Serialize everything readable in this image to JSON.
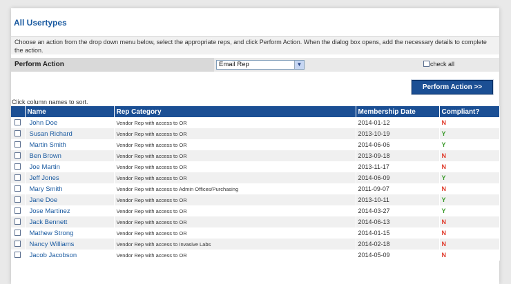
{
  "page": {
    "title": "All Usertypes",
    "instructions": "Choose an action from the drop down menu below, select the appropriate reps, and click Perform Action. When the dialog box opens, add the necessary details to complete the action.",
    "perform_action_label": "Perform Action",
    "action_select_value": "Email Rep",
    "check_all_label": "check all",
    "perform_button_label": "Perform Action >>",
    "sort_hint": "Click column names to sort."
  },
  "table": {
    "columns": [
      "Name",
      "Rep Category",
      "Membership Date",
      "Compliant?"
    ],
    "rows": [
      {
        "name": "John Doe",
        "category": "Vendor Rep with access to OR",
        "date": "2014-01-12",
        "compliant": "N"
      },
      {
        "name": "Susan Richard",
        "category": "Vendor Rep with access to OR",
        "date": "2013-10-19",
        "compliant": "Y"
      },
      {
        "name": "Martin Smith",
        "category": "Vendor Rep with access to OR",
        "date": "2014-06-06",
        "compliant": "Y"
      },
      {
        "name": "Ben Brown",
        "category": "Vendor Rep with access to OR",
        "date": "2013-09-18",
        "compliant": "N"
      },
      {
        "name": "Joe Martin",
        "category": "Vendor Rep with access to OR",
        "date": "2013-11-17",
        "compliant": "N"
      },
      {
        "name": "Jeff Jones",
        "category": "Vendor Rep with access to OR",
        "date": "2014-06-09",
        "compliant": "Y"
      },
      {
        "name": "Mary Smith",
        "category": "Vendor Rep with access to Admin Offices/Purchasing",
        "date": "2011-09-07",
        "compliant": "N"
      },
      {
        "name": "Jane Doe",
        "category": "Vendor Rep with access to OR",
        "date": "2013-10-11",
        "compliant": "Y"
      },
      {
        "name": "Jose Martinez",
        "category": "Vendor Rep with access to OR",
        "date": "2014-03-27",
        "compliant": "Y"
      },
      {
        "name": "Jack Bennett",
        "category": "Vendor Rep with access to OR",
        "date": "2014-06-13",
        "compliant": "N"
      },
      {
        "name": "Mathew Strong",
        "category": "Vendor Rep with access to OR",
        "date": "2014-01-15",
        "compliant": "N"
      },
      {
        "name": "Nancy Williams",
        "category": "Vendor Rep with access to Invasive Labs",
        "date": "2014-02-18",
        "compliant": "N"
      },
      {
        "name": "Jacob Jacobson",
        "category": "Vendor Rep with access to OR",
        "date": "2014-05-09",
        "compliant": "N"
      }
    ]
  },
  "colors": {
    "accent": "#1b4f94",
    "link": "#1a5aa0",
    "compliant_yes": "#3a9a2a",
    "compliant_no": "#e03a2a"
  },
  "icons": {
    "select_arrow": "chevron-down-icon",
    "row_checkbox": "checkbox-icon"
  }
}
